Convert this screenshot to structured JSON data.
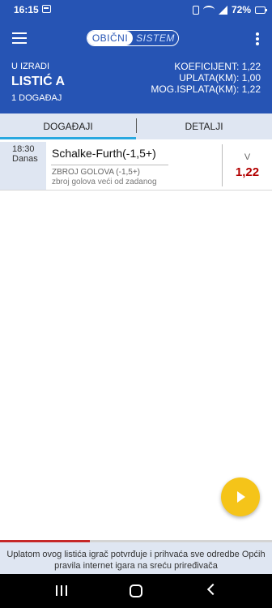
{
  "status_bar": {
    "time": "16:15",
    "battery": "72%",
    "icons": [
      "gallery-icon",
      "lock-icon",
      "wifi-icon",
      "signal-icon",
      "battery-icon"
    ]
  },
  "app_bar": {
    "menu_icon": "hamburger-icon",
    "toggle": {
      "active": "OBIČNI",
      "inactive": "SISTEM"
    },
    "overflow_icon": "more-vert-icon"
  },
  "ticket": {
    "status": "U IZRADI",
    "name": "LISTIĆ A",
    "count": "1 DOGAĐAJ",
    "koeficijent": "KOEFICIJENT: 1,22",
    "uplata": "UPLATA(KM): 1,00",
    "isplata": "MOG.ISPLATA(KM): 1,22"
  },
  "tabs": [
    {
      "label": "DOGAĐAJI",
      "active": true
    },
    {
      "label": "DETALJI",
      "active": false
    }
  ],
  "event": {
    "time": "18:30",
    "day": "Danas",
    "name": "Schalke-Furth(-1,5+)",
    "market": "ZBROJ GOLOVA (-1,5+)",
    "description": "zbroj golova veći od zadanog",
    "selection": "V",
    "odd": "1,22"
  },
  "fab": {
    "icon": "play-icon"
  },
  "progress": {
    "fraction": 0.33,
    "color": "#c62828"
  },
  "disclaimer": "Uplatom ovog listića igrač potvrđuje i prihvaća sve odredbe Općih pravila internet igara na sreću priređivača",
  "colors": {
    "primary": "#2654b4",
    "accent": "#29a8e0",
    "odd": "#b30000",
    "fab": "#f5c419"
  },
  "navbar": {
    "icons": [
      "recents-icon",
      "home-icon",
      "back-icon"
    ]
  }
}
